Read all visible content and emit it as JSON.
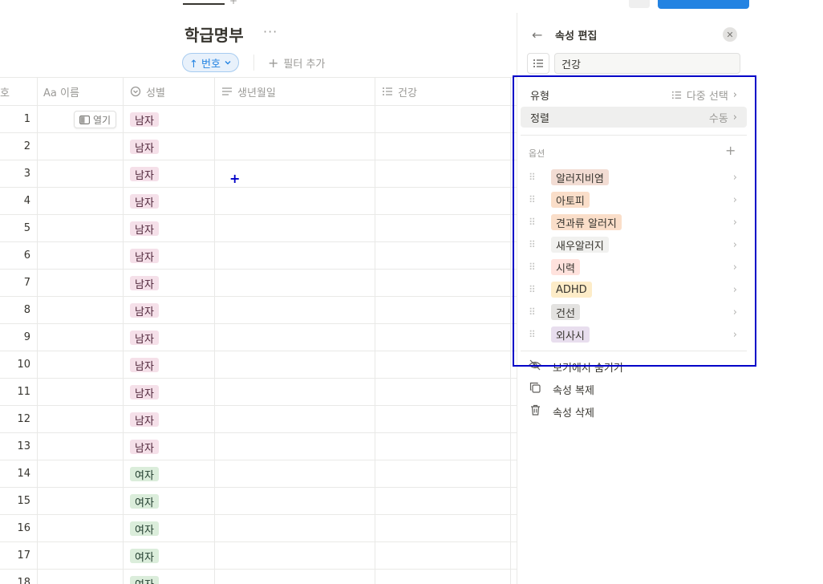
{
  "page": {
    "title": "학급명부",
    "more": "···"
  },
  "toolbar": {
    "sort_label": "↑ 번호",
    "filter_add_label": "필터 추가"
  },
  "table": {
    "columns": [
      {
        "name": "Aa 이름",
        "icon": "text-icon"
      },
      {
        "name": "성별",
        "icon": "select-icon"
      },
      {
        "name": "생년월일",
        "icon": "lines-icon"
      },
      {
        "name": "건강",
        "icon": "list-icon"
      }
    ],
    "first_col_fragment": "호",
    "open_label": "열기",
    "rows": [
      {
        "num": "1",
        "gender": "남자"
      },
      {
        "num": "2",
        "gender": "남자"
      },
      {
        "num": "3",
        "gender": "남자"
      },
      {
        "num": "4",
        "gender": "남자"
      },
      {
        "num": "5",
        "gender": "남자"
      },
      {
        "num": "6",
        "gender": "남자"
      },
      {
        "num": "7",
        "gender": "남자"
      },
      {
        "num": "8",
        "gender": "남자"
      },
      {
        "num": "9",
        "gender": "남자"
      },
      {
        "num": "10",
        "gender": "남자"
      },
      {
        "num": "11",
        "gender": "남자"
      },
      {
        "num": "12",
        "gender": "남자"
      },
      {
        "num": "13",
        "gender": "남자"
      },
      {
        "num": "14",
        "gender": "여자"
      },
      {
        "num": "15",
        "gender": "여자"
      },
      {
        "num": "16",
        "gender": "여자"
      },
      {
        "num": "17",
        "gender": "여자"
      },
      {
        "num": "18",
        "gender": "여자"
      }
    ],
    "colors": {
      "male_bg": "#f5e0e9",
      "female_bg": "#dbeddb"
    }
  },
  "panel": {
    "title": "속성 편집",
    "name_value": "건강",
    "type_label": "유형",
    "type_value": "다중 선택",
    "sort_label": "정렬",
    "sort_value": "수동",
    "options_label": "옵션",
    "options": [
      {
        "label": "알러지비염",
        "color": "#f2dcd3"
      },
      {
        "label": "아토피",
        "color": "#fadec9"
      },
      {
        "label": "견과류 알러지",
        "color": "#fadec9"
      },
      {
        "label": "새우알러지",
        "color": "#f1f1ef"
      },
      {
        "label": "시력",
        "color": "#ffe2dd"
      },
      {
        "label": "ADHD",
        "color": "#fdecc8"
      },
      {
        "label": "건선",
        "color": "#e3e2e0"
      },
      {
        "label": "외사시",
        "color": "#e8deee"
      }
    ],
    "actions": [
      {
        "label": "보기에서 숨기기",
        "icon": "eye-off-icon"
      },
      {
        "label": "속성 복제",
        "icon": "duplicate-icon"
      },
      {
        "label": "속성 삭제",
        "icon": "trash-icon"
      }
    ]
  },
  "highlight_color": "#0000c8"
}
